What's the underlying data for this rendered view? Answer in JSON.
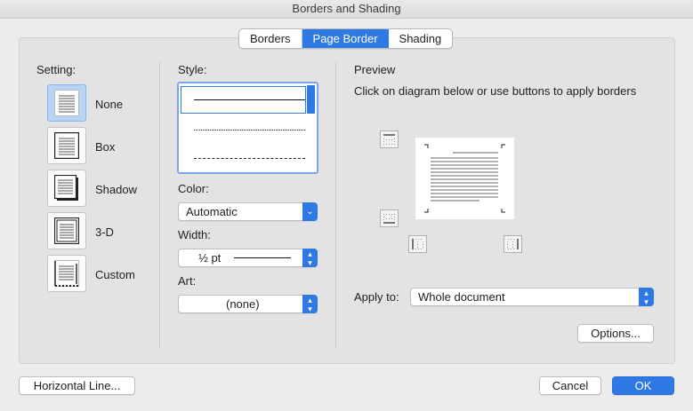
{
  "window": {
    "title": "Borders and Shading"
  },
  "tabs": [
    {
      "label": "Borders"
    },
    {
      "label": "Page Border"
    },
    {
      "label": "Shading"
    }
  ],
  "setting": {
    "label": "Setting:",
    "items": [
      {
        "label": "None",
        "icon": "setting-none-icon",
        "selected": true
      },
      {
        "label": "Box",
        "icon": "setting-box-icon"
      },
      {
        "label": "Shadow",
        "icon": "setting-shadow-icon"
      },
      {
        "label": "3-D",
        "icon": "setting-3d-icon"
      },
      {
        "label": "Custom",
        "icon": "setting-custom-icon"
      }
    ]
  },
  "style": {
    "label": "Style:",
    "options": [
      "solid",
      "dotted",
      "dashed"
    ],
    "selected": "solid"
  },
  "color": {
    "label": "Color:",
    "value": "Automatic"
  },
  "width": {
    "label": "Width:",
    "value": "½ pt"
  },
  "art": {
    "label": "Art:",
    "value": "(none)"
  },
  "preview": {
    "title": "Preview",
    "instructions": "Click on diagram below or use buttons to apply borders"
  },
  "apply": {
    "label": "Apply to:",
    "value": "Whole document"
  },
  "buttons": {
    "options": "Options...",
    "horizontal_line": "Horizontal Line...",
    "cancel": "Cancel",
    "ok": "OK"
  },
  "colors": {
    "accent": "#2f79e5",
    "selected_setting": "#b7d3f6"
  }
}
